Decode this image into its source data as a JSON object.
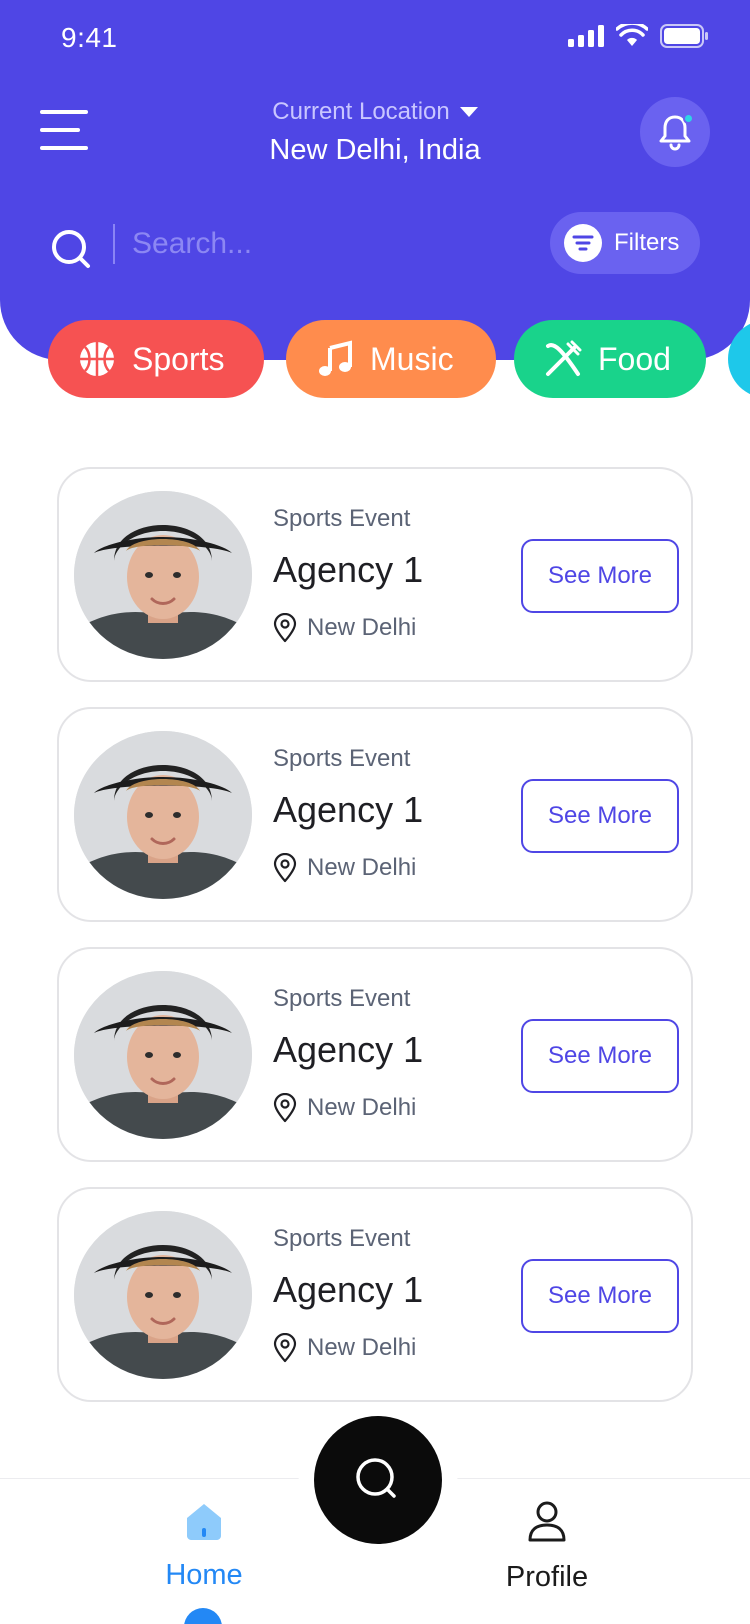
{
  "status_bar": {
    "time": "9:41"
  },
  "header": {
    "location_label": "Current Location",
    "location_value": "New Delhi, India"
  },
  "search": {
    "placeholder": "Search...",
    "filters_label": "Filters"
  },
  "categories": [
    {
      "label": "Sports",
      "icon": "basketball-icon",
      "color": "#F65252"
    },
    {
      "label": "Music",
      "icon": "music-note-icon",
      "color": "#FF8C4D"
    },
    {
      "label": "Food",
      "icon": "fork-knife-icon",
      "color": "#19D38B"
    }
  ],
  "events": [
    {
      "category": "Sports Event",
      "title": "Agency 1",
      "location": "New Delhi",
      "button": "See More"
    },
    {
      "category": "Sports Event",
      "title": "Agency 1",
      "location": "New Delhi",
      "button": "See More"
    },
    {
      "category": "Sports Event",
      "title": "Agency 1",
      "location": "New Delhi",
      "button": "See More"
    },
    {
      "category": "Sports Event",
      "title": "Agency 1",
      "location": "New Delhi",
      "button": "See More"
    }
  ],
  "nav": {
    "home_label": "Home",
    "profile_label": "Profile"
  },
  "colors": {
    "primary": "#4F46E5",
    "active_nav": "#2388F5"
  }
}
